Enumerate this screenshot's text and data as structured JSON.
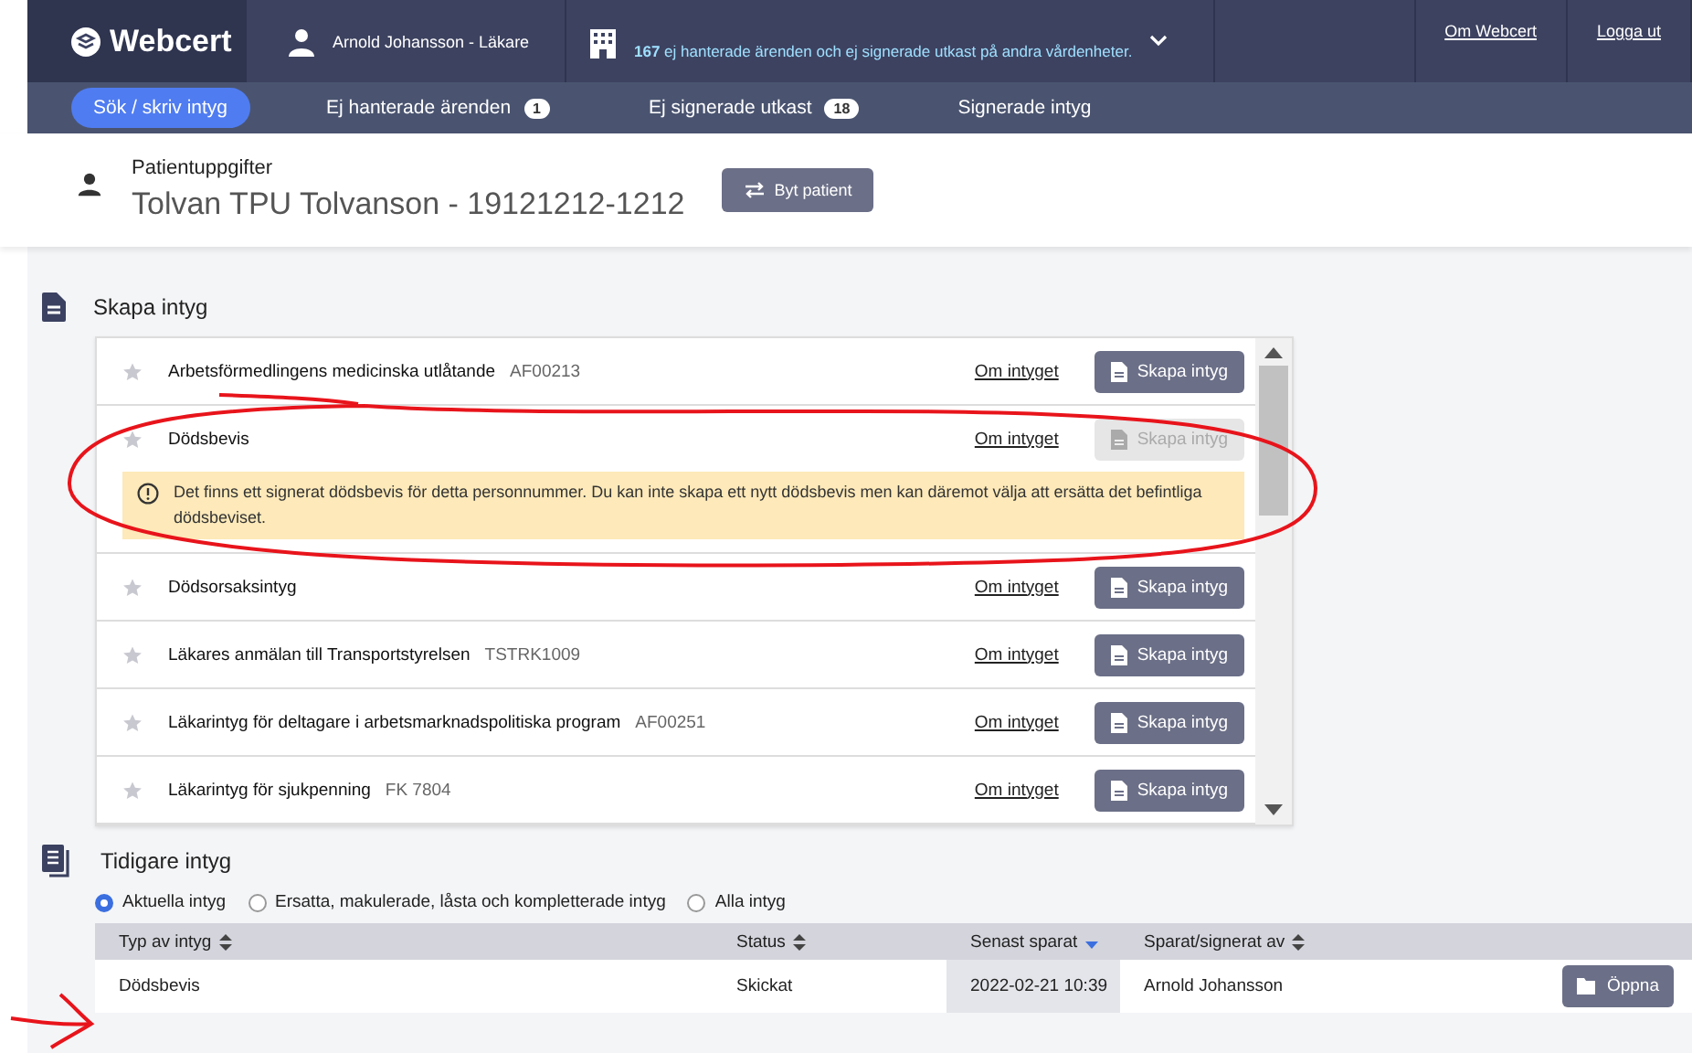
{
  "header": {
    "logo": "Webcert",
    "user": "Arnold Johansson - Läkare",
    "unit_notice": {
      "count": "167",
      "text": "ej hanterade ärenden och ej signerade utkast på andra vårdenheter."
    },
    "links": [
      "Om Webcert",
      "Logga ut"
    ]
  },
  "nav": {
    "tabs": [
      {
        "label": "Sök / skriv intyg",
        "selected": true
      },
      {
        "label": "Ej hanterade ärenden",
        "badge": "1",
        "selected": false
      },
      {
        "label": "Ej signerade utkast",
        "badge": "18",
        "selected": false
      },
      {
        "label": "Signerade intyg",
        "selected": false
      }
    ]
  },
  "patient": {
    "heading": "Patientuppgifter",
    "name": "Tolvan TPU Tolvanson - 19121212-1212",
    "button": "Byt patient"
  },
  "create_section": {
    "title": "Skapa intyg",
    "certificates": [
      {
        "name": "Arbetsförmedlingens medicinska utlåtande",
        "code": "AF00213",
        "link": "Om intyget",
        "button": "Skapa intyg",
        "disabled": false
      },
      {
        "name": "Dödsbevis",
        "link": "Om intyget",
        "button": "Skapa intyg",
        "disabled": true,
        "warning": "Det finns ett signerat dödsbevis för detta personnummer. Du kan inte skapa ett nytt dödsbevis men kan däremot välja att ersätta det befintliga dödsbeviset."
      },
      {
        "name": "Dödsorsaksintyg",
        "link": "Om intyget",
        "button": "Skapa intyg",
        "disabled": false
      },
      {
        "name": "Läkares anmälan till Transportstyrelsen",
        "code": "TSTRK1009",
        "link": "Om intyget",
        "button": "Skapa intyg",
        "disabled": false
      },
      {
        "name": "Läkarintyg för deltagare i arbetsmarknadspolitiska program",
        "code": "AF00251",
        "link": "Om intyget",
        "button": "Skapa intyg",
        "disabled": false
      },
      {
        "name": "Läkarintyg för sjukpenning",
        "code": "FK 7804",
        "link": "Om intyget",
        "button": "Skapa intyg",
        "disabled": false
      }
    ]
  },
  "previous_section": {
    "title": "Tidigare intyg",
    "filters": [
      {
        "label": "Aktuella intyg",
        "selected": true
      },
      {
        "label": "Ersatta, makulerade, låsta och kompletterade intyg",
        "selected": false
      },
      {
        "label": "Alla intyg",
        "selected": false
      }
    ],
    "table": {
      "columns": [
        {
          "label": "Typ av intyg",
          "active_sort": false
        },
        {
          "label": "Status",
          "active_sort": false
        },
        {
          "label": "Senast sparat",
          "active_sort": true
        },
        {
          "label": "Sparat/signerat av",
          "active_sort": false
        }
      ],
      "rows": [
        {
          "type": "Dödsbevis",
          "status": "Skickat",
          "saved": "2022-02-21 10:39",
          "signed_by": "Arnold Johansson",
          "button": "Öppna"
        }
      ]
    }
  }
}
